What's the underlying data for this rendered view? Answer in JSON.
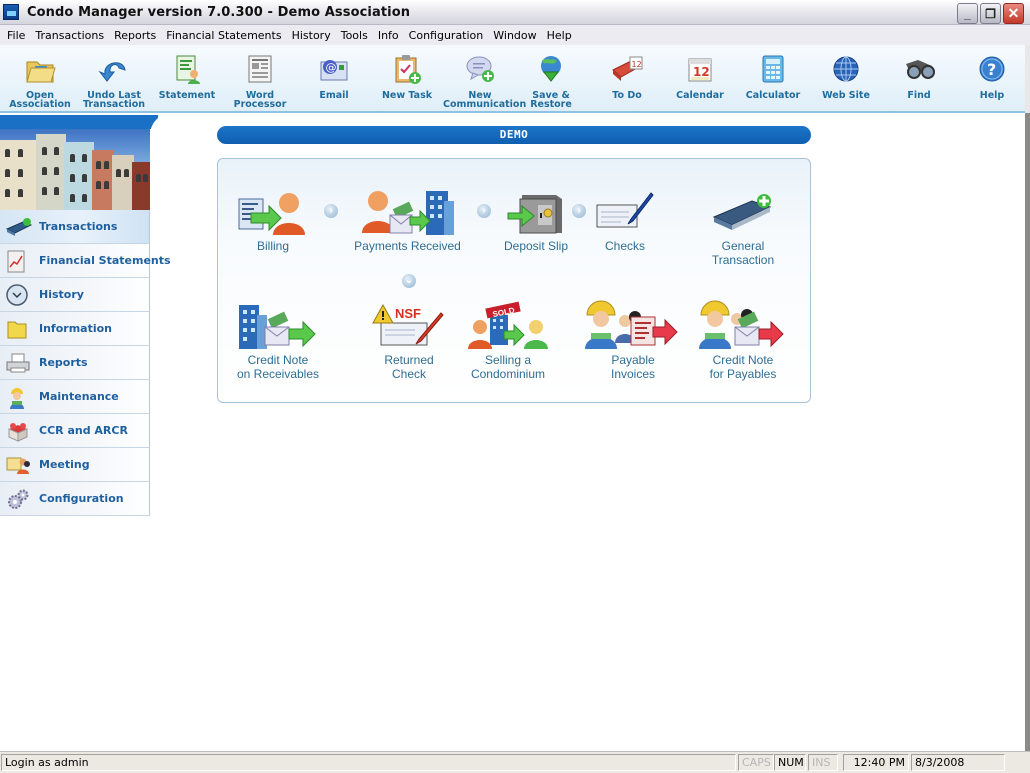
{
  "window": {
    "title": "Condo Manager version 7.0.300 - Demo Association",
    "controls": {
      "minimize": "_",
      "restore": "❐",
      "close": "✕"
    }
  },
  "menubar": {
    "items": [
      "File",
      "Transactions",
      "Reports",
      "Financial Statements",
      "History",
      "Tools",
      "Info",
      "Configuration",
      "Window",
      "Help"
    ]
  },
  "toolbar": {
    "items": [
      {
        "label_line1": "Open",
        "label_line2": "Association",
        "icon": "folder-open-icon"
      },
      {
        "label_line1": "Undo Last",
        "label_line2": "Transaction",
        "icon": "undo-icon"
      },
      {
        "label_line1": "Statement",
        "label_line2": "",
        "icon": "statement-icon"
      },
      {
        "label_line1": "Word",
        "label_line2": "Processor",
        "icon": "word-processor-icon"
      },
      {
        "label_line1": "Email",
        "label_line2": "",
        "icon": "email-icon"
      },
      {
        "label_line1": "New Task",
        "label_line2": "",
        "icon": "new-task-icon"
      },
      {
        "label_line1": "New",
        "label_line2": "Communication",
        "icon": "new-communication-icon"
      },
      {
        "label_line1": "Save &",
        "label_line2": "Restore",
        "icon": "save-restore-icon"
      },
      {
        "label_line1": "To Do",
        "label_line2": "",
        "icon": "todo-icon"
      },
      {
        "label_line1": "Calendar",
        "label_line2": "",
        "icon": "calendar-icon"
      },
      {
        "label_line1": "Calculator",
        "label_line2": "",
        "icon": "calculator-icon"
      },
      {
        "label_line1": "Web Site",
        "label_line2": "",
        "icon": "globe-icon"
      },
      {
        "label_line1": "Find",
        "label_line2": "",
        "icon": "binoculars-icon"
      },
      {
        "label_line1": "Help",
        "label_line2": "",
        "icon": "help-icon"
      }
    ]
  },
  "sidebar": {
    "items": [
      {
        "label": "Transactions",
        "icon": "ledger-icon",
        "active": true
      },
      {
        "label": "Financial Statements",
        "icon": "chart-document-icon",
        "active": false
      },
      {
        "label": "History",
        "icon": "clock-icon",
        "active": false
      },
      {
        "label": "Information",
        "icon": "folder-icon",
        "active": false
      },
      {
        "label": "Reports",
        "icon": "printer-icon",
        "active": false
      },
      {
        "label": "Maintenance",
        "icon": "worker-icon",
        "active": false
      },
      {
        "label": "CCR and ARCR",
        "icon": "box-icon",
        "active": false
      },
      {
        "label": "Meeting",
        "icon": "meeting-icon",
        "active": false
      },
      {
        "label": "Configuration",
        "icon": "gears-icon",
        "active": false
      }
    ]
  },
  "main": {
    "association_banner": "DEMO",
    "transactions": [
      {
        "line1": "Billing",
        "line2": ""
      },
      {
        "line1": "Payments Received",
        "line2": ""
      },
      {
        "line1": "Deposit Slip",
        "line2": ""
      },
      {
        "line1": "Checks",
        "line2": ""
      },
      {
        "line1": "General",
        "line2": "Transaction"
      },
      {
        "line1": "Credit Note",
        "line2": "on Receivables"
      },
      {
        "line1": "Returned",
        "line2": "Check"
      },
      {
        "line1": "Selling a",
        "line2": "Condominium"
      },
      {
        "line1": "Payable",
        "line2": "Invoices"
      },
      {
        "line1": "Credit Note",
        "line2": "for Payables"
      }
    ],
    "nsf_badge": "NSF",
    "sold_badge": "SOLD",
    "calendar_day": "12"
  },
  "statusbar": {
    "login": "Login as admin",
    "caps": "CAPS",
    "num": "NUM",
    "ins": "INS",
    "time": "12:40 PM",
    "date": "8/3/2008"
  }
}
